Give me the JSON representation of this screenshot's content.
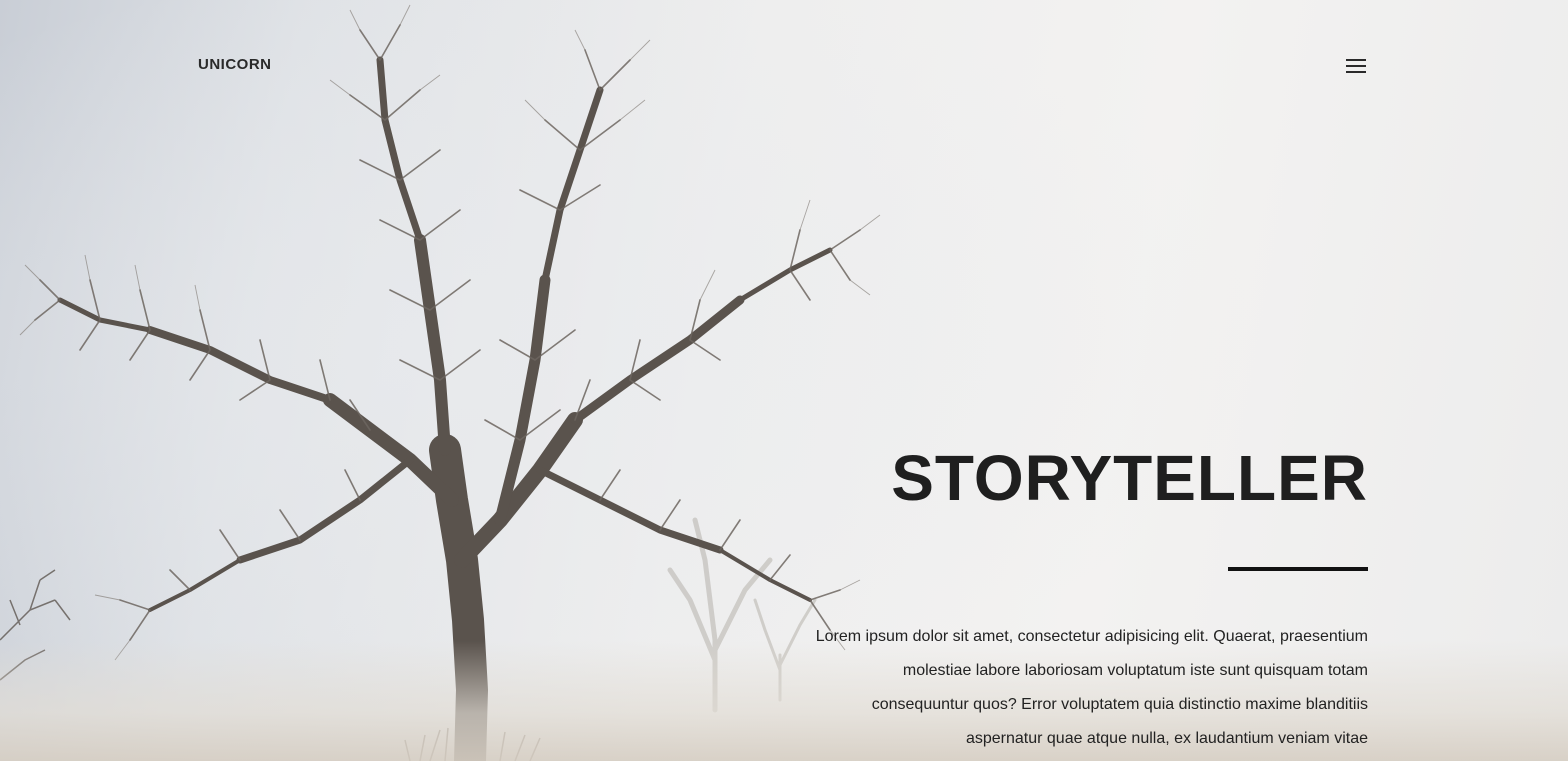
{
  "header": {
    "brand": "UNICORN",
    "menu_icon": "hamburger-menu-icon"
  },
  "hero": {
    "title": "STORYTELLER",
    "body": "Lorem ipsum dolor sit amet, consectetur adipisicing elit. Quaerat, praesentium molestiae labore laboriosam voluptatum iste sunt quisquam totam consequuntur quos? Error voluptatem quia distinctio maxime blanditiis aspernatur quae atque nulla, ex laudantium veniam vitae"
  },
  "colors": {
    "text": "#222222",
    "rule": "#111111"
  }
}
